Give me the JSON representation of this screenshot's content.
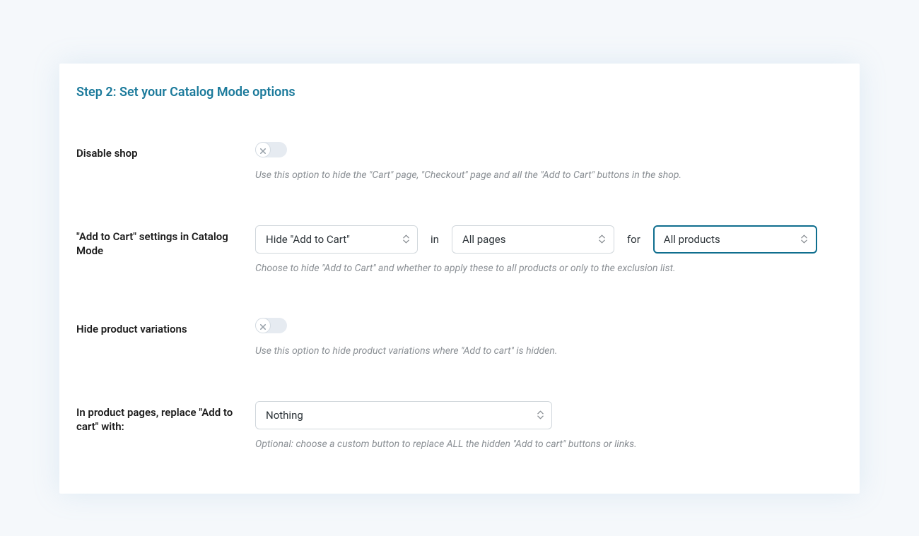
{
  "step_title": "Step 2: Set your Catalog Mode options",
  "fields": {
    "disable_shop": {
      "label": "Disable shop",
      "description": "Use this option to hide the \"Cart\" page, \"Checkout\" page and all the \"Add to Cart\" buttons in the shop."
    },
    "add_to_cart": {
      "label": "\"Add to Cart\" settings in Catalog Mode",
      "select_action": "Hide \"Add to Cart\"",
      "sep_in": "in",
      "select_scope_pages": "All pages",
      "sep_for": "for",
      "select_scope_products": "All products",
      "description": "Choose to hide \"Add to Cart\" and whether to apply these to all products or only to the exclusion list."
    },
    "hide_variations": {
      "label": "Hide product variations",
      "description": "Use this option to hide product variations where \"Add to cart\" is hidden."
    },
    "replace_with": {
      "label": "In product pages, replace \"Add to cart\" with:",
      "select_value": "Nothing",
      "description": "Optional: choose a custom button to replace ALL the hidden \"Add to cart\" buttons or links."
    }
  }
}
